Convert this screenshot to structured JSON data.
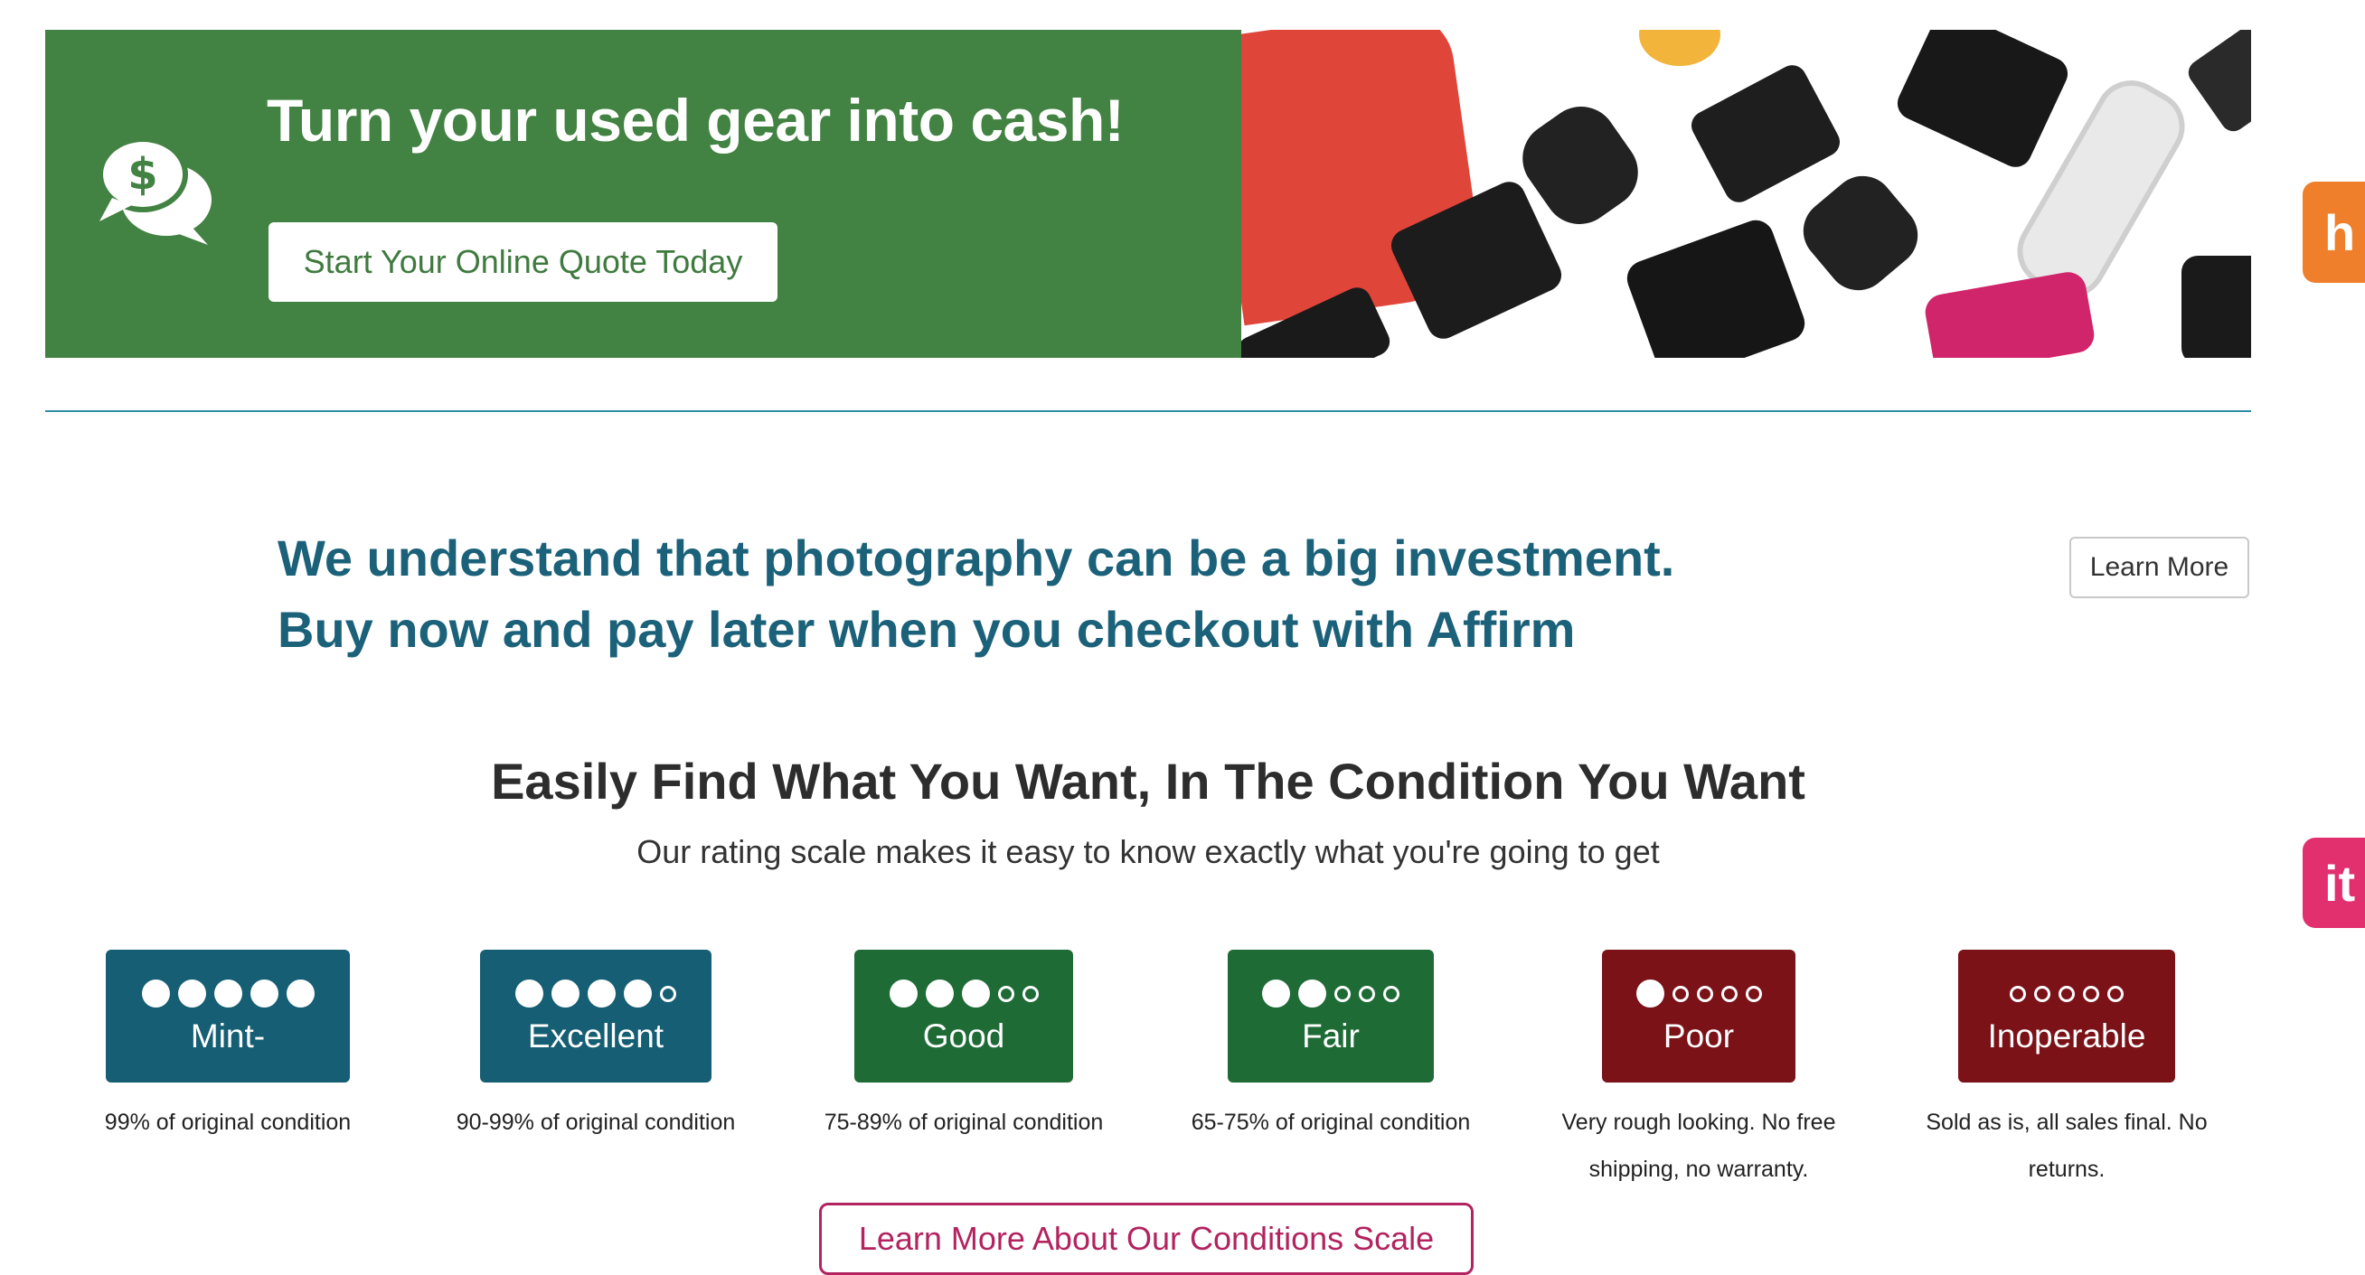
{
  "banner": {
    "title": "Turn your used gear into cash!",
    "button_label": "Start Your Online Quote Today",
    "icon": "chat-dollar-icon",
    "green_color": "#428242"
  },
  "affirm": {
    "line1": "We understand that photography can be a big investment.",
    "line2": "Buy now and pay later when you checkout with Affirm",
    "learn_more": "Learn More"
  },
  "conditions": {
    "title": "Easily Find What You Want, In The Condition You Want",
    "subtitle": "Our rating scale makes it easy to know exactly what you're going to get",
    "grades": [
      {
        "label": "Mint-",
        "filled": 5,
        "caption": "99% of original condition",
        "color": "#155e73"
      },
      {
        "label": "Excellent",
        "filled": 4,
        "caption": "90-99% of original condition",
        "color": "#155e73"
      },
      {
        "label": "Good",
        "filled": 3,
        "caption": "75-89% of original condition",
        "color": "#1e6b36"
      },
      {
        "label": "Fair",
        "filled": 2,
        "caption": "65-75% of original condition",
        "color": "#1e6b36"
      },
      {
        "label": "Poor",
        "filled": 1,
        "caption": "Very rough looking. No free shipping, no warranty.",
        "color": "#7a1218"
      },
      {
        "label": "Inoperable",
        "filled": 0,
        "caption": "Sold as is, all sales final. No returns.",
        "color": "#7a1218"
      }
    ],
    "scale_button": "Learn More About Our Conditions Scale"
  },
  "side_tabs": {
    "orange": "h",
    "pink": "it"
  }
}
